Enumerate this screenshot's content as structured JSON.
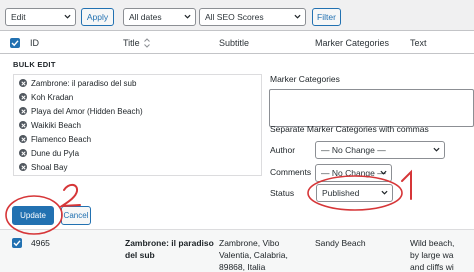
{
  "toolbar": {
    "bulk_action": "Edit",
    "apply_label": "Apply",
    "dates_filter": "All dates",
    "seo_filter": "All SEO Scores",
    "filter_label": "Filter"
  },
  "table_header": {
    "id": "ID",
    "title": "Title",
    "subtitle": "Subtitle",
    "marker_categories": "Marker Categories",
    "text": "Text"
  },
  "bulk_edit": {
    "title": "BULK EDIT",
    "items": [
      "Zambrone: il paradiso del sub",
      "Koh Kradan",
      "Playa del Amor (Hidden Beach)",
      "Waikiki Beach",
      "Flamenco Beach",
      "Dune du Pyla",
      "Shoal Bay"
    ],
    "marker_categories_label": "Marker Categories",
    "marker_categories_hint": "Separate Marker Categories with commas",
    "author_label": "Author",
    "author_value": "— No Change —",
    "comments_label": "Comments",
    "comments_value": "— No Change —",
    "status_label": "Status",
    "status_value": "Published",
    "update_label": "Update",
    "cancel_label": "Cancel"
  },
  "row": {
    "id": "4965",
    "title_line1": "Zambrone: il paradiso",
    "title_line2": "del sub",
    "subtitle_line1": "Zambrone, Vibo",
    "subtitle_line2": "Valentia, Calabria,",
    "subtitle_line3": "89868, Italia",
    "marker_category": "Sandy Beach",
    "text_line1": "Wild beach,",
    "text_line2": "by large wa",
    "text_line3": "and cliffs wi"
  },
  "annotations": {
    "label_1": "1",
    "label_2": "2"
  },
  "colors": {
    "accent": "#2271b1",
    "annotation": "#d63638",
    "panel_bg": "#ffffff",
    "page_bg": "#f0f0f1"
  }
}
